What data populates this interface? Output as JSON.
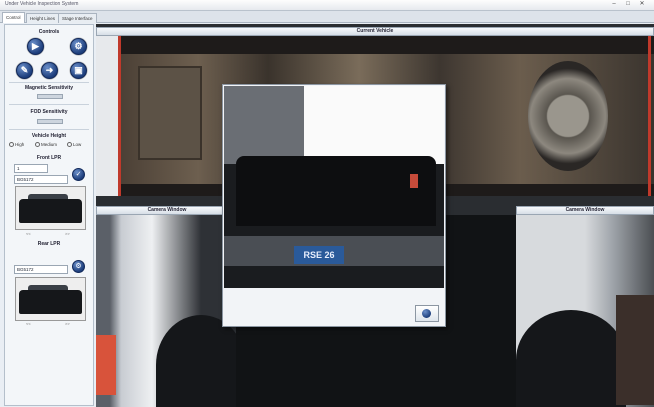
{
  "window": {
    "title": "Under Vehicle Inspection System"
  },
  "tabs": [
    {
      "label": "Control",
      "active": true
    },
    {
      "label": "Height Lines"
    },
    {
      "label": "Stage Interface"
    }
  ],
  "sidebar": {
    "controls_label": "Controls",
    "buttons": [
      {
        "icon": "play-icon",
        "glyph": "▶"
      },
      {
        "icon": "settings-icon",
        "glyph": "⚙"
      },
      {
        "icon": "edit-icon",
        "glyph": "✎"
      },
      {
        "icon": "arrow-right-icon",
        "glyph": "➜"
      },
      {
        "icon": "save-icon",
        "glyph": "▣"
      }
    ],
    "magnetic_sensitivity_label": "Magnetic Sensitivity",
    "fod_sensitivity_label": "FOD Sensitivity",
    "vehicle_height_label": "Vehicle Height",
    "vehicle_height_options": [
      "High",
      "Medium",
      "Low"
    ],
    "front_lpr_label": "Front LPR",
    "front_lpr_small": "1",
    "front_lpr_value": "BG5172",
    "rear_lpr_label": "Rear LPR",
    "rear_lpr_value": "BG5172",
    "front_thumb_nav": [
      "<<",
      ">>"
    ],
    "rear_thumb_nav": [
      "<<",
      ">>"
    ]
  },
  "panels": {
    "current_vehicle": "Current Vehicle",
    "camera_left": "Camera Window",
    "camera_right": "Camera Window"
  },
  "dialog": {
    "plate_text": "RSE 26"
  },
  "colors": {
    "accent": "#1d3e7c",
    "undercar": "#2c2624",
    "highlight": "#c0392b"
  }
}
